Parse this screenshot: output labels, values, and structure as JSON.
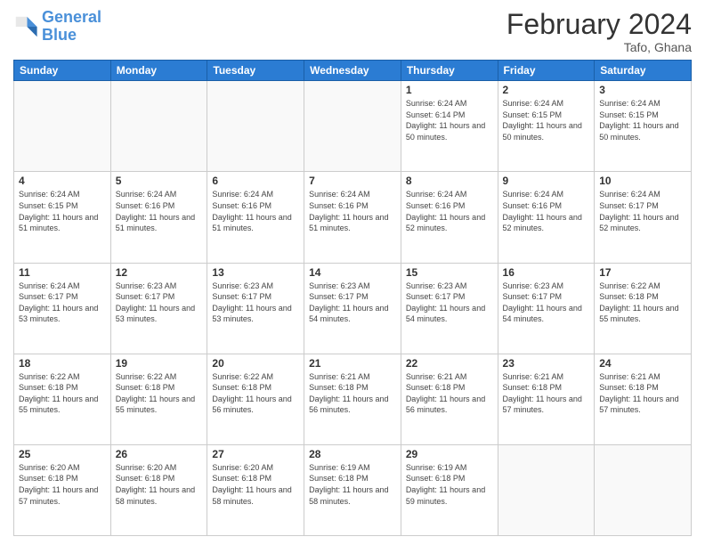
{
  "header": {
    "logo_line1": "General",
    "logo_line2": "Blue",
    "title": "February 2024",
    "subtitle": "Tafo, Ghana"
  },
  "days_of_week": [
    "Sunday",
    "Monday",
    "Tuesday",
    "Wednesday",
    "Thursday",
    "Friday",
    "Saturday"
  ],
  "weeks": [
    [
      {
        "day": "",
        "info": ""
      },
      {
        "day": "",
        "info": ""
      },
      {
        "day": "",
        "info": ""
      },
      {
        "day": "",
        "info": ""
      },
      {
        "day": "1",
        "info": "Sunrise: 6:24 AM\nSunset: 6:14 PM\nDaylight: 11 hours\nand 50 minutes."
      },
      {
        "day": "2",
        "info": "Sunrise: 6:24 AM\nSunset: 6:15 PM\nDaylight: 11 hours\nand 50 minutes."
      },
      {
        "day": "3",
        "info": "Sunrise: 6:24 AM\nSunset: 6:15 PM\nDaylight: 11 hours\nand 50 minutes."
      }
    ],
    [
      {
        "day": "4",
        "info": "Sunrise: 6:24 AM\nSunset: 6:15 PM\nDaylight: 11 hours\nand 51 minutes."
      },
      {
        "day": "5",
        "info": "Sunrise: 6:24 AM\nSunset: 6:16 PM\nDaylight: 11 hours\nand 51 minutes."
      },
      {
        "day": "6",
        "info": "Sunrise: 6:24 AM\nSunset: 6:16 PM\nDaylight: 11 hours\nand 51 minutes."
      },
      {
        "day": "7",
        "info": "Sunrise: 6:24 AM\nSunset: 6:16 PM\nDaylight: 11 hours\nand 51 minutes."
      },
      {
        "day": "8",
        "info": "Sunrise: 6:24 AM\nSunset: 6:16 PM\nDaylight: 11 hours\nand 52 minutes."
      },
      {
        "day": "9",
        "info": "Sunrise: 6:24 AM\nSunset: 6:16 PM\nDaylight: 11 hours\nand 52 minutes."
      },
      {
        "day": "10",
        "info": "Sunrise: 6:24 AM\nSunset: 6:17 PM\nDaylight: 11 hours\nand 52 minutes."
      }
    ],
    [
      {
        "day": "11",
        "info": "Sunrise: 6:24 AM\nSunset: 6:17 PM\nDaylight: 11 hours\nand 53 minutes."
      },
      {
        "day": "12",
        "info": "Sunrise: 6:23 AM\nSunset: 6:17 PM\nDaylight: 11 hours\nand 53 minutes."
      },
      {
        "day": "13",
        "info": "Sunrise: 6:23 AM\nSunset: 6:17 PM\nDaylight: 11 hours\nand 53 minutes."
      },
      {
        "day": "14",
        "info": "Sunrise: 6:23 AM\nSunset: 6:17 PM\nDaylight: 11 hours\nand 54 minutes."
      },
      {
        "day": "15",
        "info": "Sunrise: 6:23 AM\nSunset: 6:17 PM\nDaylight: 11 hours\nand 54 minutes."
      },
      {
        "day": "16",
        "info": "Sunrise: 6:23 AM\nSunset: 6:17 PM\nDaylight: 11 hours\nand 54 minutes."
      },
      {
        "day": "17",
        "info": "Sunrise: 6:22 AM\nSunset: 6:18 PM\nDaylight: 11 hours\nand 55 minutes."
      }
    ],
    [
      {
        "day": "18",
        "info": "Sunrise: 6:22 AM\nSunset: 6:18 PM\nDaylight: 11 hours\nand 55 minutes."
      },
      {
        "day": "19",
        "info": "Sunrise: 6:22 AM\nSunset: 6:18 PM\nDaylight: 11 hours\nand 55 minutes."
      },
      {
        "day": "20",
        "info": "Sunrise: 6:22 AM\nSunset: 6:18 PM\nDaylight: 11 hours\nand 56 minutes."
      },
      {
        "day": "21",
        "info": "Sunrise: 6:21 AM\nSunset: 6:18 PM\nDaylight: 11 hours\nand 56 minutes."
      },
      {
        "day": "22",
        "info": "Sunrise: 6:21 AM\nSunset: 6:18 PM\nDaylight: 11 hours\nand 56 minutes."
      },
      {
        "day": "23",
        "info": "Sunrise: 6:21 AM\nSunset: 6:18 PM\nDaylight: 11 hours\nand 57 minutes."
      },
      {
        "day": "24",
        "info": "Sunrise: 6:21 AM\nSunset: 6:18 PM\nDaylight: 11 hours\nand 57 minutes."
      }
    ],
    [
      {
        "day": "25",
        "info": "Sunrise: 6:20 AM\nSunset: 6:18 PM\nDaylight: 11 hours\nand 57 minutes."
      },
      {
        "day": "26",
        "info": "Sunrise: 6:20 AM\nSunset: 6:18 PM\nDaylight: 11 hours\nand 58 minutes."
      },
      {
        "day": "27",
        "info": "Sunrise: 6:20 AM\nSunset: 6:18 PM\nDaylight: 11 hours\nand 58 minutes."
      },
      {
        "day": "28",
        "info": "Sunrise: 6:19 AM\nSunset: 6:18 PM\nDaylight: 11 hours\nand 58 minutes."
      },
      {
        "day": "29",
        "info": "Sunrise: 6:19 AM\nSunset: 6:18 PM\nDaylight: 11 hours\nand 59 minutes."
      },
      {
        "day": "",
        "info": ""
      },
      {
        "day": "",
        "info": ""
      }
    ]
  ]
}
